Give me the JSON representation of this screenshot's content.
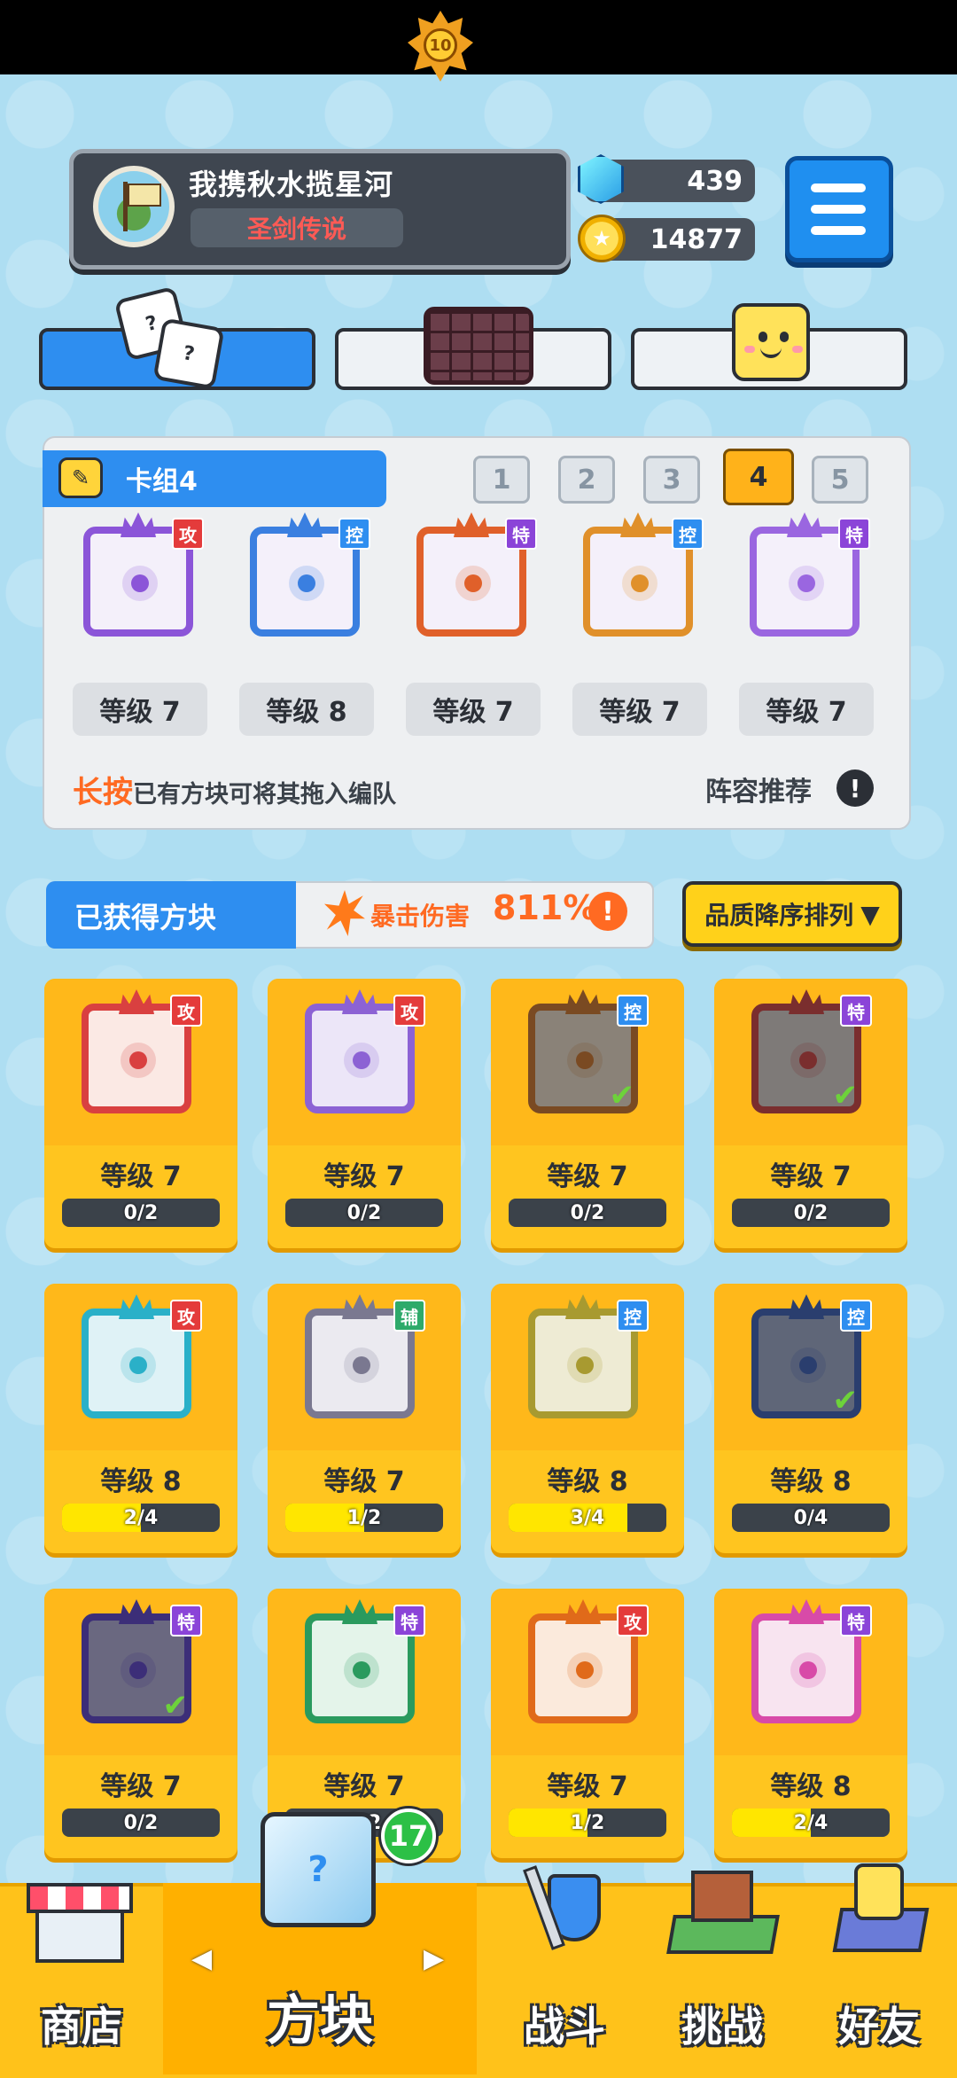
{
  "profile": {
    "name": "我携秋水揽星河",
    "title": "圣剑传说",
    "rank": "10"
  },
  "currency": {
    "gems": "439",
    "gold": "14877"
  },
  "tabs": [
    {
      "icon": "dice-icon",
      "active": true
    },
    {
      "icon": "grid-icon",
      "active": false
    },
    {
      "icon": "smiley-icon",
      "active": false
    }
  ],
  "deck": {
    "title": "卡组4",
    "numbers": [
      "1",
      "2",
      "3",
      "4",
      "5"
    ],
    "selected": "4",
    "cards": [
      {
        "tag": "攻",
        "level": "等级 7",
        "color": "#8b55d8"
      },
      {
        "tag": "控",
        "level": "等级 8",
        "color": "#3a7fe0"
      },
      {
        "tag": "特",
        "level": "等级 7",
        "color": "#e0602a"
      },
      {
        "tag": "控",
        "level": "等级 7",
        "color": "#e0902a"
      },
      {
        "tag": "特",
        "level": "等级 7",
        "color": "#9a66e0"
      }
    ],
    "hint_emphasis": "长按",
    "hint_text": "已有方块可将其拖入编队",
    "recommend": "阵容推荐"
  },
  "obtained": {
    "title": "已获得方块",
    "crit_label": "暴击伤害",
    "crit_value": "811%",
    "sort_label": "品质降序排列",
    "cards": [
      {
        "tag": "攻",
        "level": "等级 7",
        "progress": "0/2",
        "fill": 0,
        "color": "#d94040",
        "art": "#fbe9e4",
        "check": false
      },
      {
        "tag": "攻",
        "level": "等级 7",
        "progress": "0/2",
        "fill": 0,
        "color": "#8c62d4",
        "art": "#ece6f8",
        "check": false
      },
      {
        "tag": "控",
        "level": "等级 7",
        "progress": "0/2",
        "fill": 0,
        "color": "#7a4a22",
        "art": "#8a8278",
        "check": true
      },
      {
        "tag": "特",
        "level": "等级 7",
        "progress": "0/2",
        "fill": 0,
        "color": "#7a2e2e",
        "art": "#7e7a78",
        "check": true
      },
      {
        "tag": "攻",
        "level": "等级 8",
        "progress": "2/4",
        "fill": 0.5,
        "color": "#2ab0c8",
        "art": "#dff2f6",
        "check": false
      },
      {
        "tag": "辅",
        "level": "等级 7",
        "progress": "1/2",
        "fill": 0.5,
        "color": "#7a7890",
        "art": "#ebeaf0",
        "check": false
      },
      {
        "tag": "控",
        "level": "等级 8",
        "progress": "3/4",
        "fill": 0.75,
        "color": "#a89a30",
        "art": "#eeebd4",
        "check": false
      },
      {
        "tag": "控",
        "level": "等级 8",
        "progress": "0/4",
        "fill": 0,
        "color": "#2a3e6e",
        "art": "#5f6678",
        "check": true
      },
      {
        "tag": "特",
        "level": "等级 7",
        "progress": "0/2",
        "fill": 0,
        "color": "#3c2e78",
        "art": "#6a6880",
        "check": true
      },
      {
        "tag": "特",
        "level": "等级 7",
        "progress": "0/2",
        "fill": 0,
        "color": "#2a9a5e",
        "art": "#e4f4ea",
        "check": false
      },
      {
        "tag": "攻",
        "level": "等级 7",
        "progress": "1/2",
        "fill": 0.5,
        "color": "#e06a1a",
        "art": "#fbeadc",
        "check": false
      },
      {
        "tag": "特",
        "level": "等级 8",
        "progress": "2/4",
        "fill": 0.5,
        "color": "#d84aa8",
        "art": "#f8e4f0",
        "check": false
      }
    ]
  },
  "nav": {
    "shop": "商店",
    "blocks": "方块",
    "battle": "战斗",
    "challenge": "挑战",
    "friends": "好友",
    "blocks_badge": "17"
  },
  "colors": {
    "accent_blue": "#2e8ef0",
    "nav_yellow": "#ffc21a",
    "card_yellow": "#ffc51f"
  }
}
